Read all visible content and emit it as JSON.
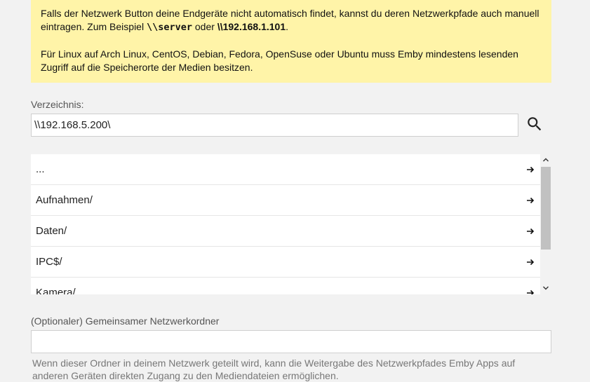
{
  "notice": {
    "p1_before": "Falls der Netzwerk Button deine Endgeräte nicht automatisch findet, kannst du deren Netzwerkpfade auch manuell eintragen. Zum Beispiel ",
    "p1_code1": "\\\\server",
    "p1_mid": " oder ",
    "p1_code2": "\\\\192.168.1.101",
    "p1_after": ".",
    "p2": "Für Linux auf Arch Linux, CentOS, Debian, Fedora, OpenSuse oder Ubuntu muss Emby mindestens lesenden Zugriff auf die Speicherorte der Medien besitzen."
  },
  "directory": {
    "label": "Verzeichnis:",
    "value": "\\\\192.168.5.200\\"
  },
  "folders": [
    {
      "name": "..."
    },
    {
      "name": "Aufnahmen/"
    },
    {
      "name": "Daten/"
    },
    {
      "name": "IPC$/"
    },
    {
      "name": "Kamera/"
    }
  ],
  "share": {
    "label": "(Optionaler) Gemeinsamer Netzwerkordner",
    "value": "",
    "hint": "Wenn dieser Ordner in deinem Netzwerk geteilt wird, kann die Weitergabe des Netzwerkpfades Emby Apps auf anderen Geräten direkten Zugang zu den Mediendateien ermöglichen."
  },
  "icons": {
    "search": "search-icon",
    "row_arrow": "arrow-right-icon",
    "scroll_up": "chevron-up-icon",
    "scroll_down": "chevron-down-icon"
  },
  "colors": {
    "notice_bg": "#fff4a8",
    "page_bg": "#f2f2f2",
    "scroll_thumb": "#c1c1c1"
  }
}
